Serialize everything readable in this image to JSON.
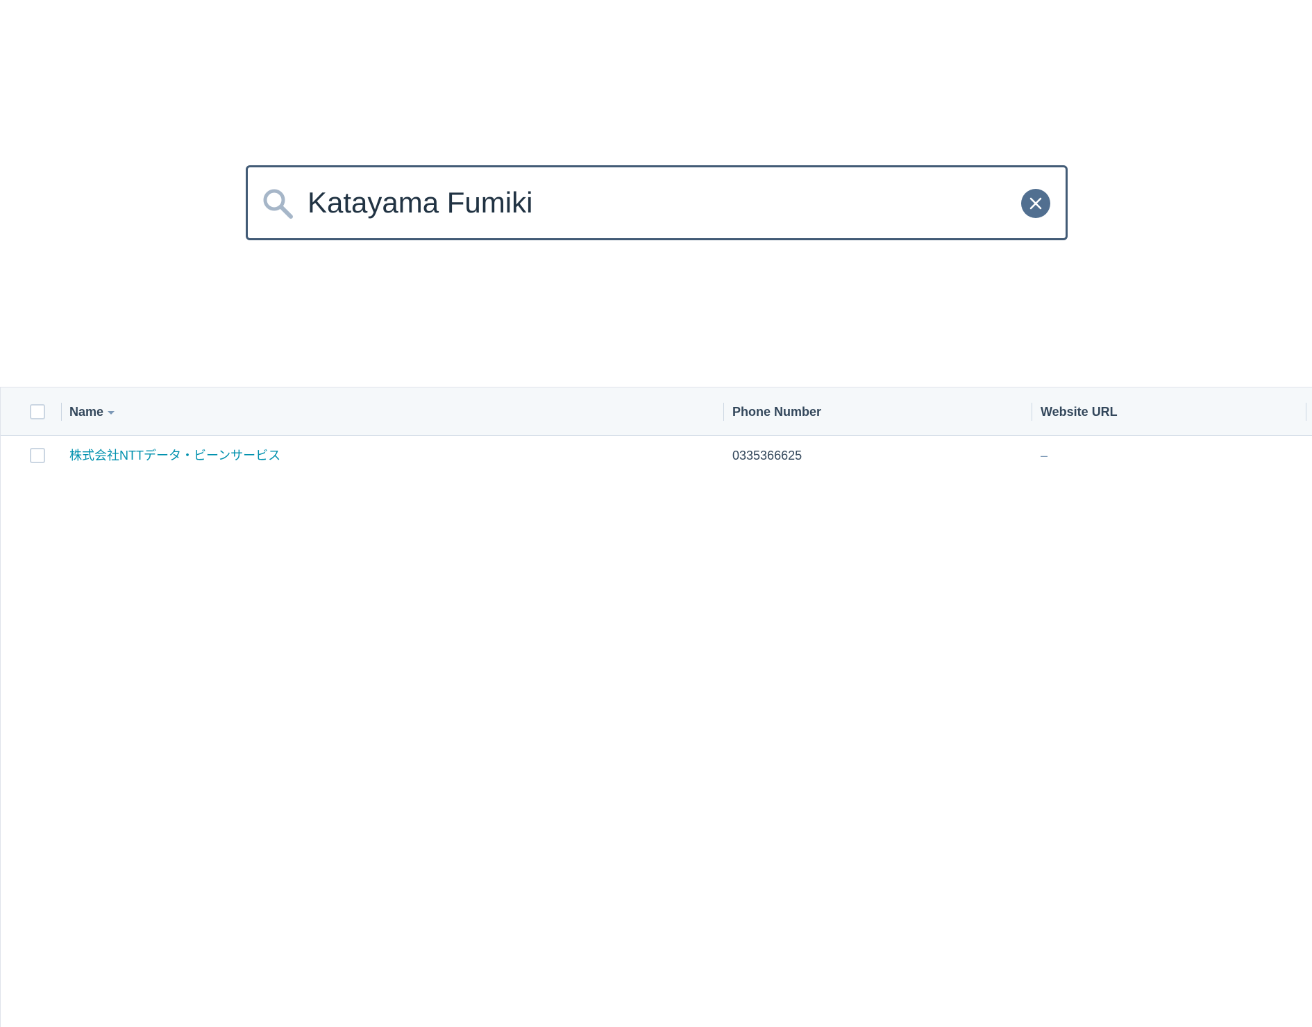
{
  "search": {
    "value": "Katayama Fumiki",
    "placeholder": ""
  },
  "table": {
    "columns": [
      {
        "label": "Name",
        "sorted": "descending"
      },
      {
        "label": "Phone Number"
      },
      {
        "label": "Website URL"
      }
    ],
    "rows": [
      {
        "name": "株式会社NTTデータ・ビーンサービス",
        "phone": "0335366625",
        "website": "–"
      }
    ]
  },
  "icons": {
    "search": "search-icon",
    "clear": "close-icon",
    "sort": "caret-down-icon"
  },
  "colors": {
    "link": "#0091ae",
    "border": "#425b76",
    "header_bg": "#f5f8fa"
  }
}
